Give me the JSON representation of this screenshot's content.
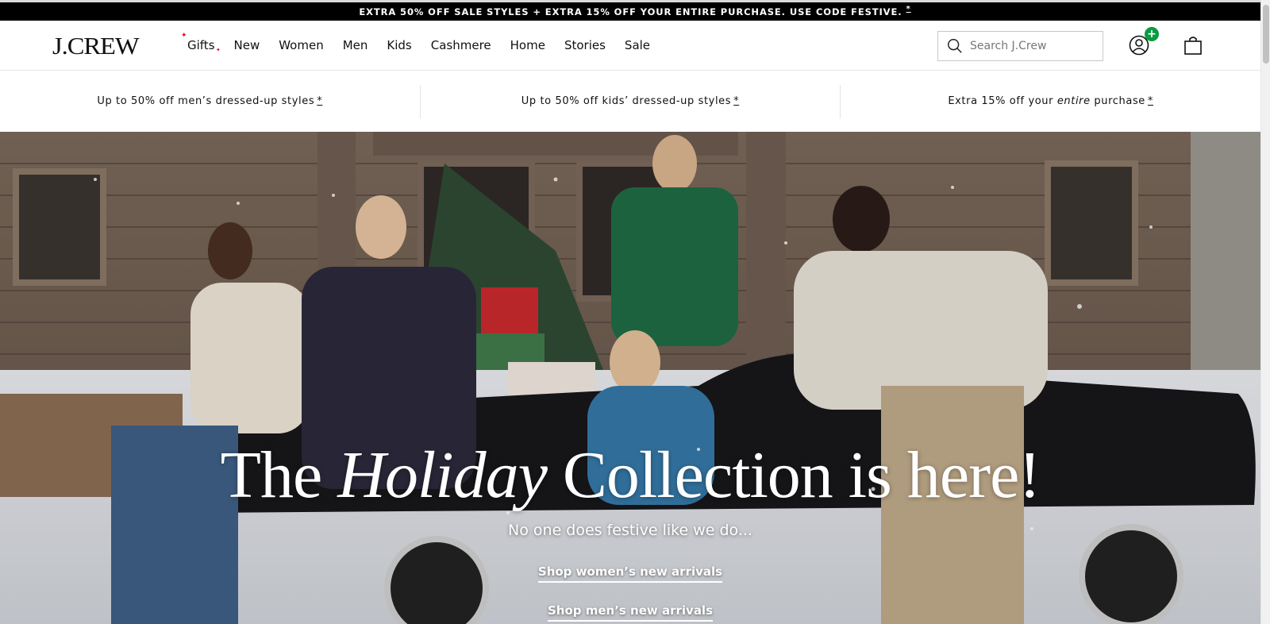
{
  "promo_bar": {
    "text": "EXTRA 50% OFF SALE STYLES + EXTRA 15% OFF YOUR ENTIRE PURCHASE. USE CODE FESTIVE.",
    "asterisk": "*"
  },
  "header": {
    "logo": "J.CREW",
    "nav": [
      "Gifts",
      "New",
      "Women",
      "Men",
      "Kids",
      "Cashmere",
      "Home",
      "Stories",
      "Sale"
    ],
    "search_placeholder": "Search J.Crew",
    "account_badge": "+"
  },
  "subpromos": [
    {
      "text": "Up to 50% off men’s dressed-up styles",
      "star": "*"
    },
    {
      "text": "Up to 50% off kids’ dressed-up styles",
      "star": "*"
    },
    {
      "pre": "Extra 15% off your ",
      "em": "entire",
      "post": " purchase",
      "star": "*"
    }
  ],
  "hero": {
    "title_pre": "The ",
    "title_em": "Holiday",
    "title_post": " Collection is here!",
    "subtitle": "No one does festive like we do...",
    "cta_women": "Shop women’s new arrivals",
    "cta_men": "Shop men’s new arrivals"
  },
  "colors": {
    "promo_bg": "#000000",
    "badge_green": "#0a9b3f",
    "sparkle_red": "#e4002b"
  }
}
